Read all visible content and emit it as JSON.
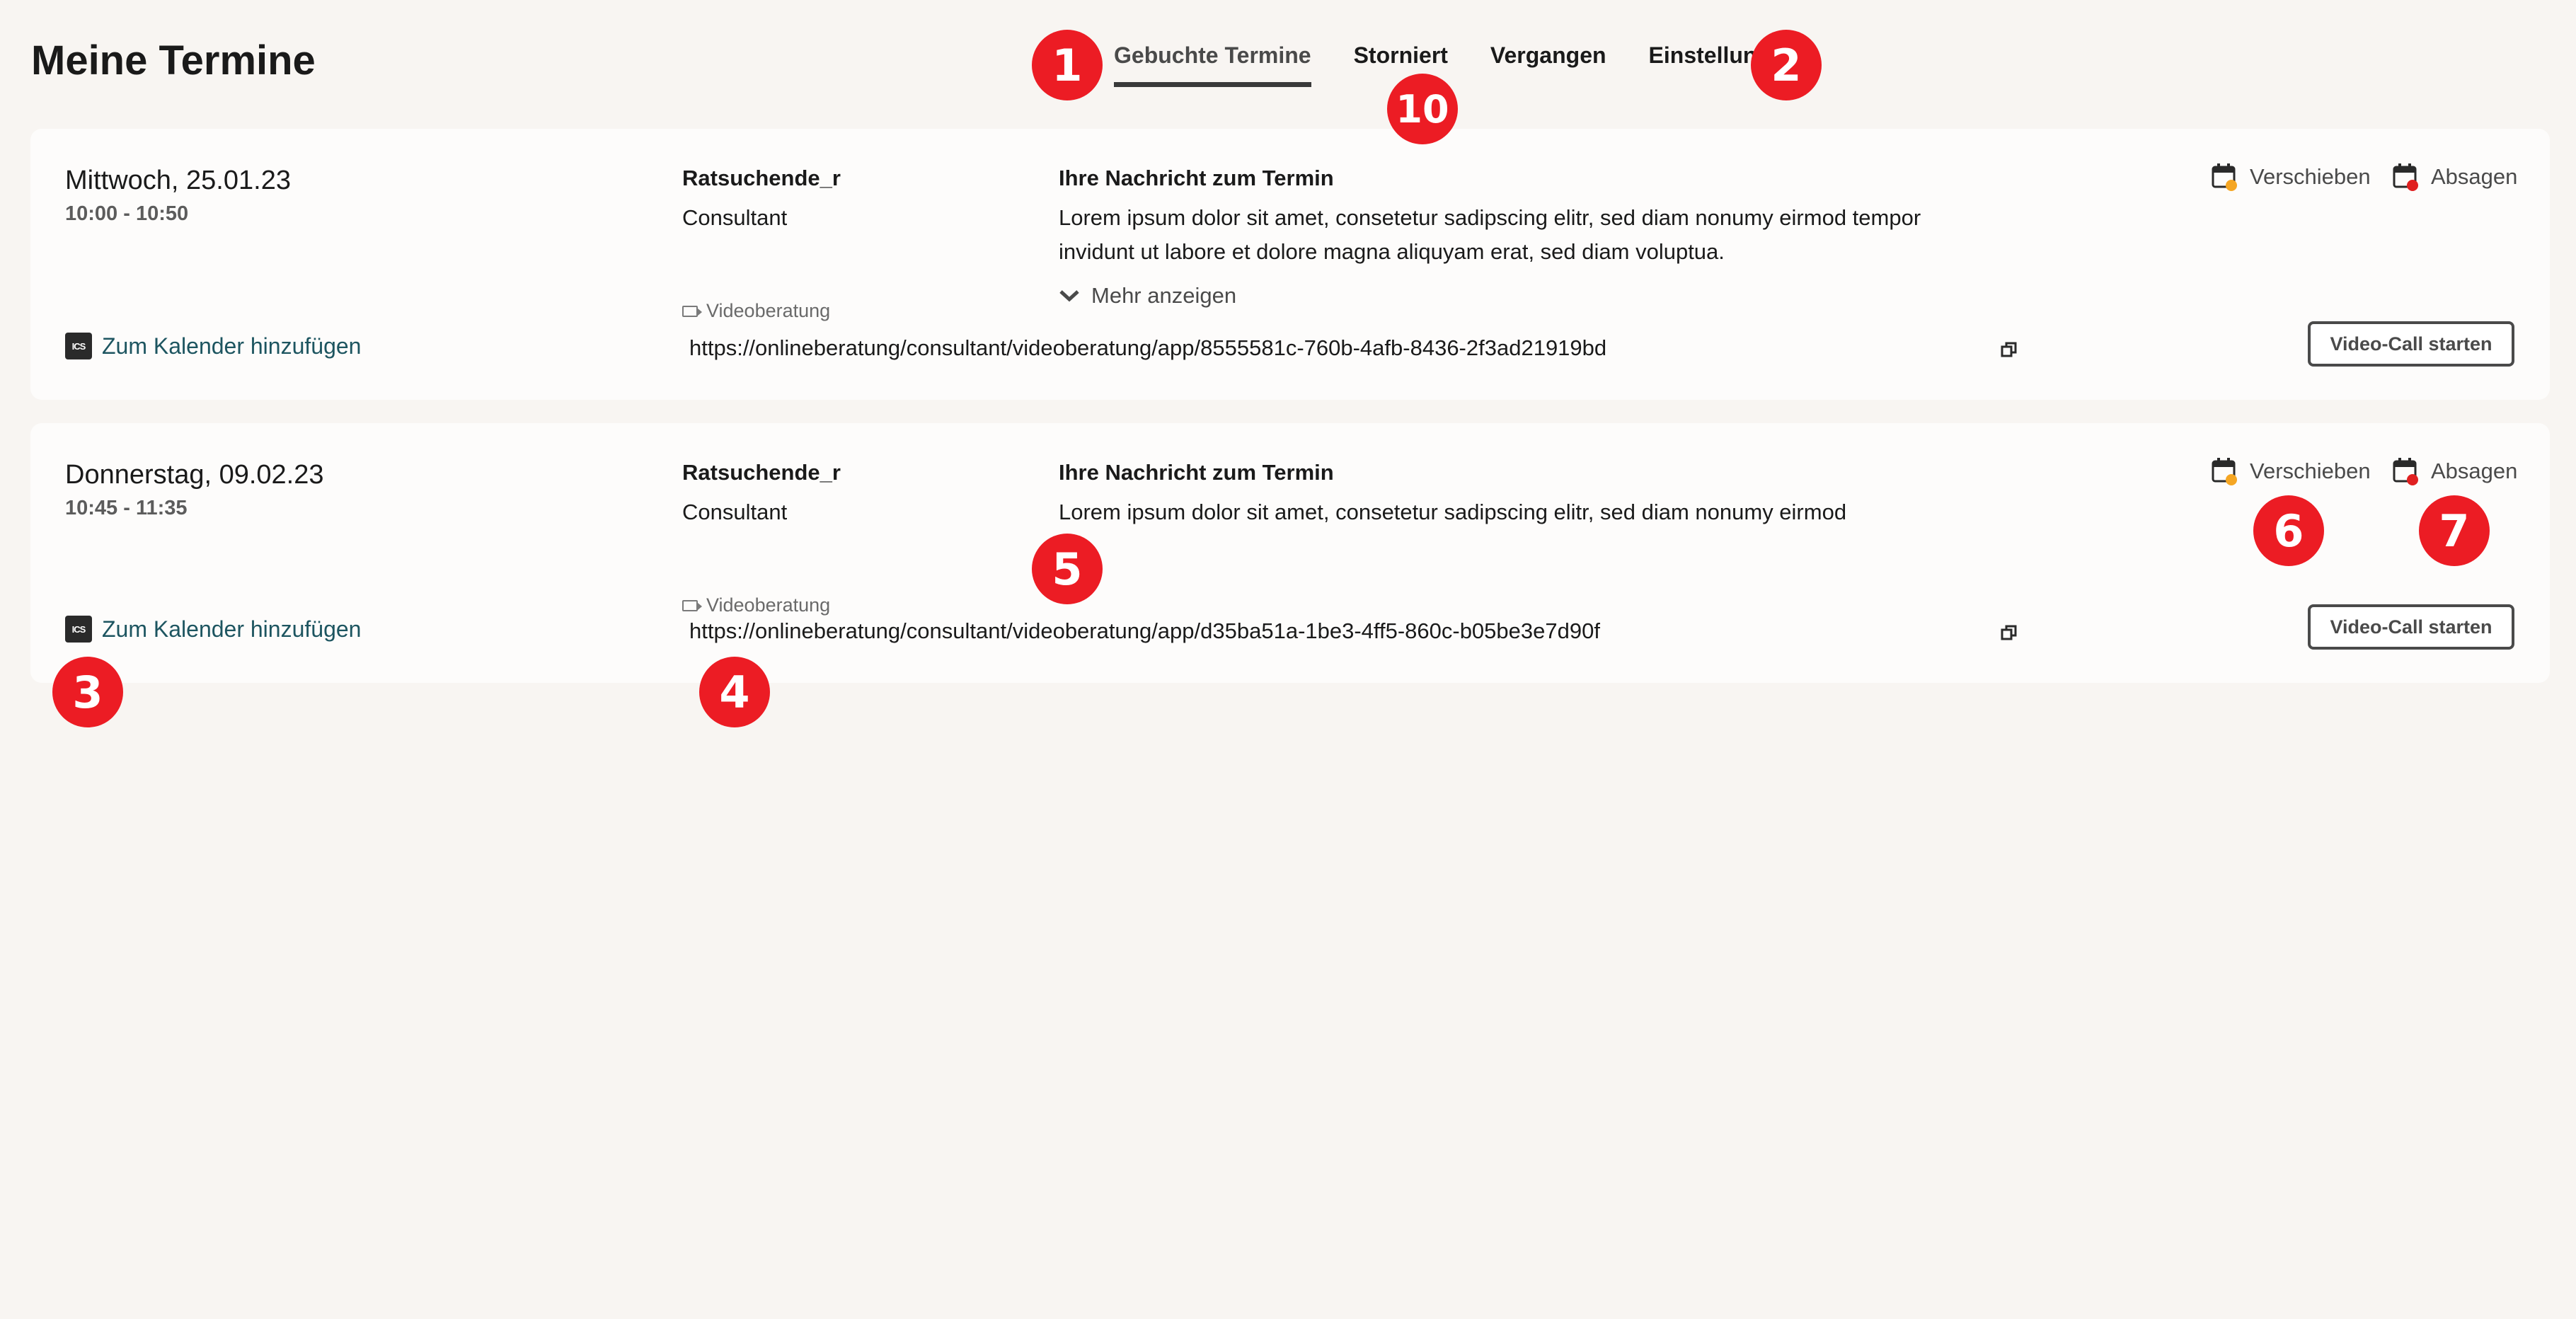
{
  "page": {
    "title": "Meine Termine"
  },
  "tabs": [
    {
      "label": "Gebuchte Termine"
    },
    {
      "label": "Storniert"
    },
    {
      "label": "Vergangen"
    },
    {
      "label": "Einstellungen"
    }
  ],
  "appointments": [
    {
      "date": "Mittwoch, 25.01.23",
      "time": "10:00 - 10:50",
      "client_name": "Ratsuchende_r",
      "client_role": "Consultant",
      "message_heading": "Ihre Nachricht zum Termin",
      "message_text": "Lorem ipsum dolor sit amet, consetetur sadipscing elitr, sed diam nonumy eirmod tempor invidunt ut labore et dolore magna aliquyam erat, sed diam voluptua.",
      "more_label": "Mehr anzeigen",
      "video_label": "Videoberatung",
      "video_url": "https://onlineberatung/consultant/videoberatung/app/8555581c-760b-4afb-8436-2f3ad21919bd",
      "calendar_link": "Zum Kalender hinzufügen",
      "reschedule_label": "Verschieben",
      "cancel_label": "Absagen",
      "video_call_label": "Video-Call starten"
    },
    {
      "date": "Donnerstag, 09.02.23",
      "time": "10:45 - 11:35",
      "client_name": "Ratsuchende_r",
      "client_role": "Consultant",
      "message_heading": "Ihre Nachricht zum Termin",
      "message_text": "Lorem ipsum dolor sit amet, consetetur sadipscing elitr, sed diam nonumy eirmod",
      "video_label": "Videoberatung",
      "video_url": "https://onlineberatung/consultant/videoberatung/app/d35ba51a-1be3-4ff5-860c-b05be3e7d90f",
      "calendar_link": "Zum Kalender hinzufügen",
      "reschedule_label": "Verschieben",
      "cancel_label": "Absagen",
      "video_call_label": "Video-Call starten"
    }
  ],
  "markers": [
    "1",
    "2",
    "10",
    "5",
    "6",
    "7",
    "3",
    "4"
  ],
  "colors": {
    "background": "#f8f5f2",
    "card": "#fdfcfb",
    "link": "#1d5560",
    "marker": "#ec1c24",
    "reschedule_badge": "#f5a623",
    "cancel_badge": "#e02020"
  },
  "icons": {
    "calendar_file": "ics-file-icon",
    "copy": "copy-icon",
    "camera": "video-camera-icon",
    "chevron": "chevron-down-icon",
    "reschedule": "calendar-reschedule-icon",
    "cancel": "calendar-cancel-icon"
  }
}
